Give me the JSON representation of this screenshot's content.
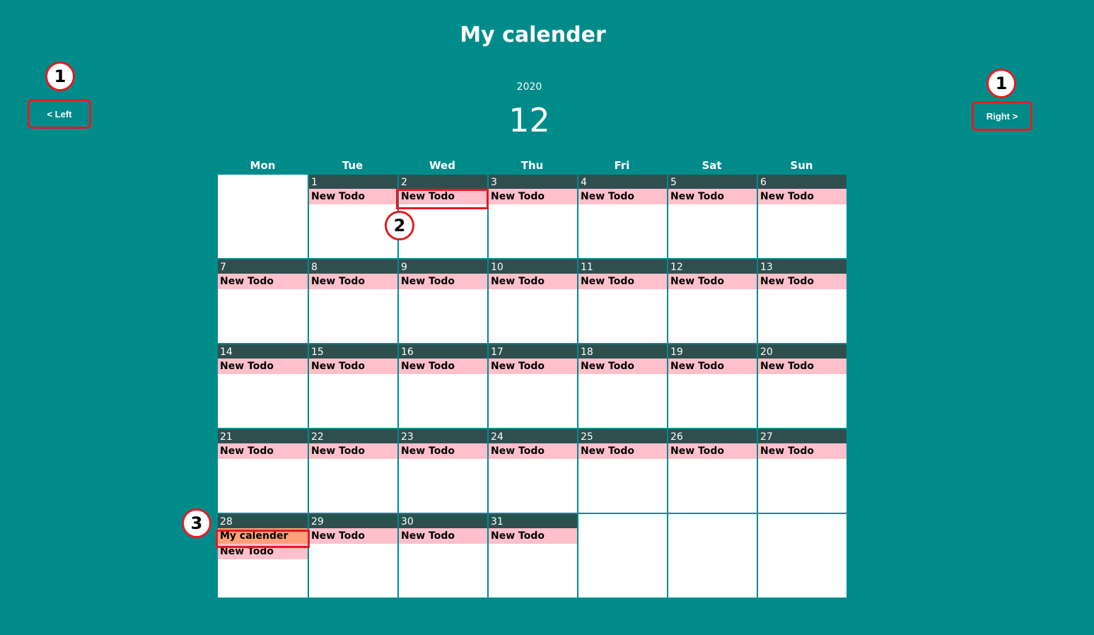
{
  "header": {
    "title": "My calender",
    "year": "2020",
    "month": "12"
  },
  "nav": {
    "left_label": "< Left",
    "right_label": "Right >"
  },
  "callouts": [
    "1",
    "1",
    "2",
    "3"
  ],
  "weekdays": [
    "Mon",
    "Tue",
    "Wed",
    "Thu",
    "Fri",
    "Sat",
    "Sun"
  ],
  "calendar": {
    "leading_blank_days": 1,
    "days": [
      {
        "day": "1",
        "todos": [
          "New Todo"
        ]
      },
      {
        "day": "2",
        "todos": [
          "New Todo"
        ]
      },
      {
        "day": "3",
        "todos": [
          "New Todo"
        ]
      },
      {
        "day": "4",
        "todos": [
          "New Todo"
        ]
      },
      {
        "day": "5",
        "todos": [
          "New Todo"
        ]
      },
      {
        "day": "6",
        "todos": [
          "New Todo"
        ]
      },
      {
        "day": "7",
        "todos": [
          "New Todo"
        ]
      },
      {
        "day": "8",
        "todos": [
          "New Todo"
        ]
      },
      {
        "day": "9",
        "todos": [
          "New Todo"
        ]
      },
      {
        "day": "10",
        "todos": [
          "New Todo"
        ]
      },
      {
        "day": "11",
        "todos": [
          "New Todo"
        ]
      },
      {
        "day": "12",
        "todos": [
          "New Todo"
        ]
      },
      {
        "day": "13",
        "todos": [
          "New Todo"
        ]
      },
      {
        "day": "14",
        "todos": [
          "New Todo"
        ]
      },
      {
        "day": "15",
        "todos": [
          "New Todo"
        ]
      },
      {
        "day": "16",
        "todos": [
          "New Todo"
        ]
      },
      {
        "day": "17",
        "todos": [
          "New Todo"
        ]
      },
      {
        "day": "18",
        "todos": [
          "New Todo"
        ]
      },
      {
        "day": "19",
        "todos": [
          "New Todo"
        ]
      },
      {
        "day": "20",
        "todos": [
          "New Todo"
        ]
      },
      {
        "day": "21",
        "todos": [
          "New Todo"
        ]
      },
      {
        "day": "22",
        "todos": [
          "New Todo"
        ]
      },
      {
        "day": "23",
        "todos": [
          "New Todo"
        ]
      },
      {
        "day": "24",
        "todos": [
          "New Todo"
        ]
      },
      {
        "day": "25",
        "todos": [
          "New Todo"
        ]
      },
      {
        "day": "26",
        "todos": [
          "New Todo"
        ]
      },
      {
        "day": "27",
        "todos": [
          "New Todo"
        ]
      },
      {
        "day": "28",
        "todos": [
          "My calender",
          "New Todo"
        ],
        "highlight": 0
      },
      {
        "day": "29",
        "todos": [
          "New Todo"
        ]
      },
      {
        "day": "30",
        "todos": [
          "New Todo"
        ]
      },
      {
        "day": "31",
        "todos": [
          "New Todo"
        ]
      }
    ],
    "trailing_blank_days": 3
  },
  "colors": {
    "background": "#008b8b",
    "day_header": "#2f4f4f",
    "todo": "#ffc0cb",
    "todo_highlight": "#ffa07a",
    "annotation": "#e31b23"
  }
}
